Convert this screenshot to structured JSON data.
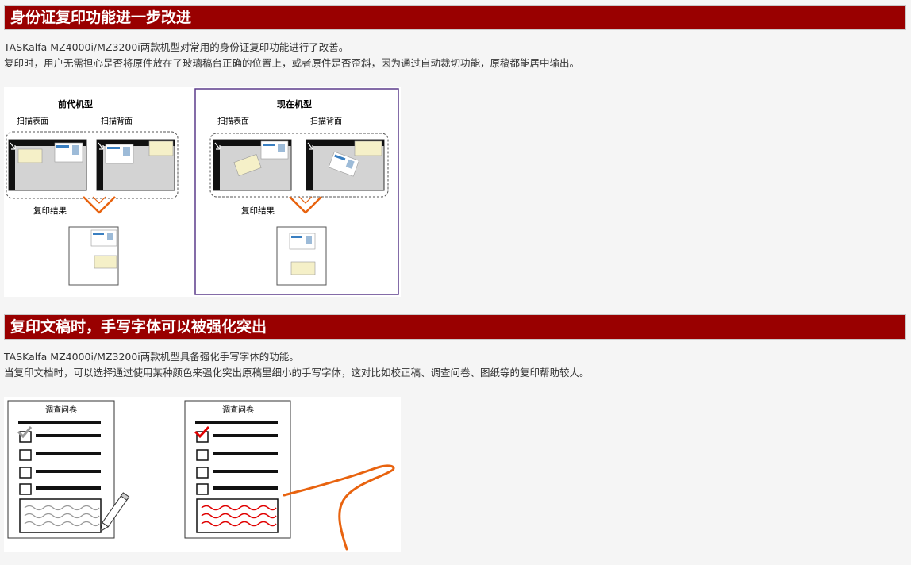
{
  "section1": {
    "title": "身份证复印功能进一步改进",
    "line1": "TASKalfa MZ4000i/MZ3200i两款机型对常用的身份证复印功能进行了改善。",
    "line2": "复印时，用户无需担心是否将原件放在了玻璃稿台正确的位置上，或者原件是否歪斜，因为通过自动裁切功能，原稿都能居中输出。",
    "figure": {
      "previous": {
        "title": "前代机型",
        "scan_front": "扫描表面",
        "scan_back": "扫描背面",
        "result": "复印结果"
      },
      "current": {
        "title": "现在机型",
        "scan_front": "扫描表面",
        "scan_back": "扫描背面",
        "result": "复印结果"
      }
    }
  },
  "section2": {
    "title": "复印文稿时，手写字体可以被强化突出",
    "line1": "TASKalfa MZ4000i/MZ3200i两款机型具备强化手写字体的功能。",
    "line2": "当复印文档时，可以选择通过使用某种颜色来强化突出原稿里细小的手写字体，这对比如校正稿、调查问卷、图纸等的复印帮助较大。",
    "figure": {
      "left_title": "调查问卷",
      "right_title": "调查问卷"
    }
  },
  "colors": {
    "header_bg": "#990000",
    "accent_orange": "#e8630f",
    "highlight_red": "#e00000",
    "frame_purple": "#5b3b8c"
  }
}
